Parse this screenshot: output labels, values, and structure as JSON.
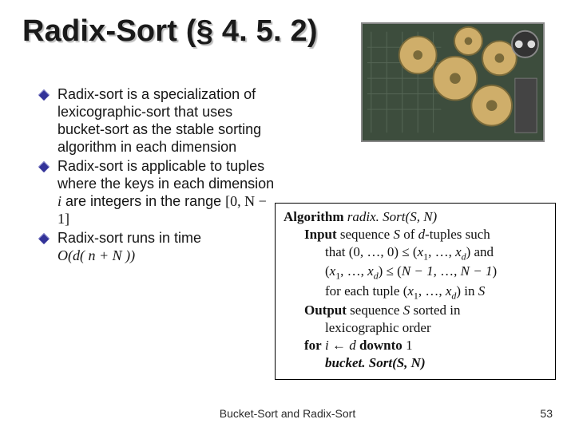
{
  "title": "Radix-Sort (§ 4. 5. 2)",
  "bullets": {
    "b1": "Radix-sort is a specialization of lexicographic-sort that uses bucket-sort as the stable sorting algorithm in each dimension",
    "b2": {
      "pre": "Radix-sort is applicable to tuples where the keys in each dimension ",
      "i": "i",
      "post": " are integers in the range "
    },
    "b3": "Radix-sort runs in time"
  },
  "math": {
    "range": "[0, N − 1]",
    "time": "O(d( n + N ))"
  },
  "algo": {
    "kw_algorithm": "Algorithm",
    "name": "radix. Sort",
    "args": "(S, N)",
    "kw_input": "Input",
    "input_rest": " sequence ",
    "S": "S",
    "of": " of ",
    "d": "d",
    "tuples_such": "-tuples such",
    "that_line": "that (0, …, 0) ≤ (",
    "x": "x",
    "one": "1",
    "comma_ell": ", …, ",
    "xd_close": ") and",
    "line3_open": "(",
    "le": ") ≤ (",
    "Nm1": "N − 1",
    "line3_close": ")",
    "for_each": "for each tuple (",
    "in_S": ") in ",
    "kw_output": "Output",
    "output_rest": " sequence ",
    "sorted_in": " sorted in",
    "lex_order": "lexicographic order",
    "kw_for": "for",
    "i_assign": "i ← d",
    "kw_downto": "downto",
    "one_num": "1",
    "bs_name": "bucket. Sort",
    "bs_args": "(S, N)"
  },
  "footer": "Bucket-Sort and Radix-Sort",
  "page": "53"
}
